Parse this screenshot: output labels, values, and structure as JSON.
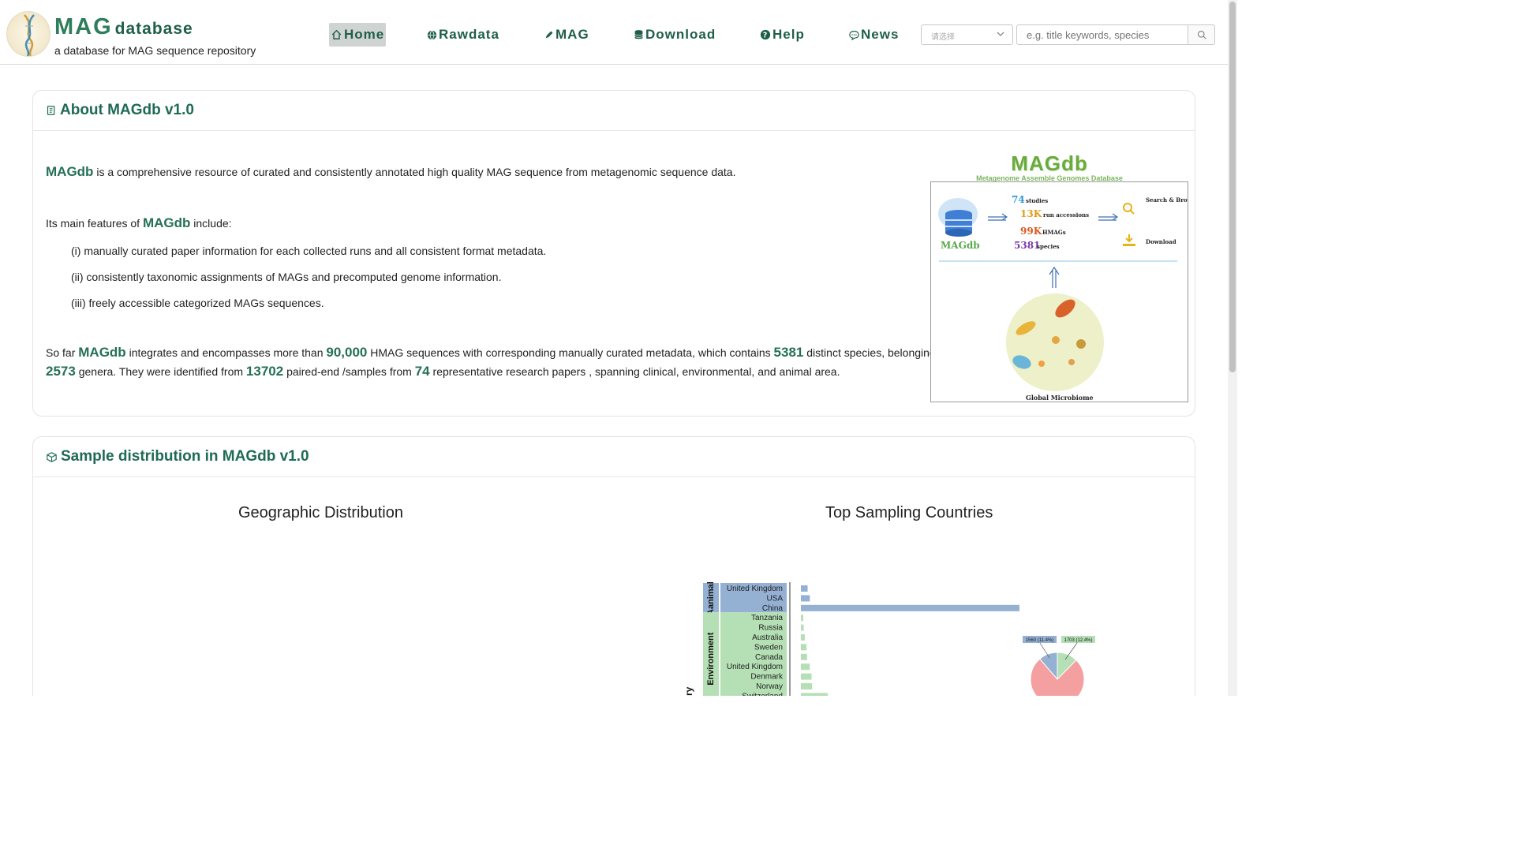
{
  "header": {
    "brand_mag": "MAG",
    "brand_db": "database",
    "subtitle": "a database for MAG sequence repository",
    "nav": [
      {
        "label": "Home",
        "icon": "home-icon"
      },
      {
        "label": "Rawdata",
        "icon": "globe-icon"
      },
      {
        "label": "MAG",
        "icon": "pen-icon"
      },
      {
        "label": "Download",
        "icon": "database-icon"
      },
      {
        "label": "Help",
        "icon": "question-icon"
      },
      {
        "label": "News",
        "icon": "chat-icon"
      }
    ],
    "lang_select_value": "请选择",
    "search_placeholder": "e.g. title keywords, species"
  },
  "about": {
    "title": "About MAGdb v1.0",
    "magdb": "MAGdb",
    "line1_rest": " is a comprehensive resource of curated and consistently annotated high quality MAG sequence from metagenomic sequence data.",
    "features_pre": "Its main features of ",
    "features_post": " include:",
    "features": [
      "(i) manually curated paper information for each collected runs and all consistent format metadata.",
      "(ii) consistently taxonomic assignments of MAGs and precomputed genome information.",
      "(iii) freely accessible categorized MAGs sequences."
    ],
    "sofar": {
      "t1": "So far ",
      "t2": " integrates and encompasses more than ",
      "n_hmag": "90,000",
      "t3": " HMAG sequences with corresponding manually curated metadata,  which contains ",
      "n_species": "5381",
      "t4": " distinct species, belonging to",
      "n_genera": "2573",
      "t5": " genera. They were identified from ",
      "n_samples": "13702",
      "t6": " paired-end /samples from ",
      "n_papers": "74",
      "t7": " representative research papers , spanning clinical, environmental, and animal area."
    }
  },
  "infographic": {
    "title": "MAGdb",
    "subtitle": "Metagenome Assemble Genomes Database",
    "studies_n": "74",
    "studies_label": "studies",
    "runs_n": "13K",
    "runs_label": "run accessions",
    "hmags_n": "99K",
    "hmags_label": "HMAGs",
    "species_n": "5381",
    "species_label": "species",
    "search_label": "Search & Browse",
    "download_label": "Download",
    "db_label": "MAGdb",
    "microbiome_label": "Global Microbiome"
  },
  "distribution": {
    "title": "Sample distribution in MAGdb v1.0",
    "geo_title": "Geographic Distribution",
    "top_title": "Top Sampling Countries"
  },
  "chart_data": {
    "type": "bar",
    "title": "Top Sampling Countries",
    "groups": [
      {
        "name": "Aanimal",
        "color": "#94b0d3",
        "categories": [
          "United Kingdom",
          "USA",
          "China"
        ],
        "values": [
          120,
          160,
          3900
        ]
      },
      {
        "name": "Environment",
        "color": "#b5e0b5",
        "categories": [
          "Tanzania",
          "Russia",
          "Australia",
          "Sweden",
          "Canada",
          "United Kingdom",
          "Denmark",
          "Norway",
          "Switzerland"
        ],
        "values": [
          40,
          50,
          70,
          100,
          110,
          160,
          190,
          200,
          480
        ]
      }
    ],
    "pie_labels": [
      "1560 (11.4%)",
      "1703 (12.4%)"
    ],
    "pie_values": [
      11.4,
      12.4,
      76.2
    ],
    "pie_colors": [
      "#94b0d3",
      "#b5e0b5",
      "#f4a0a0"
    ],
    "axis_label_partial": "ry"
  }
}
